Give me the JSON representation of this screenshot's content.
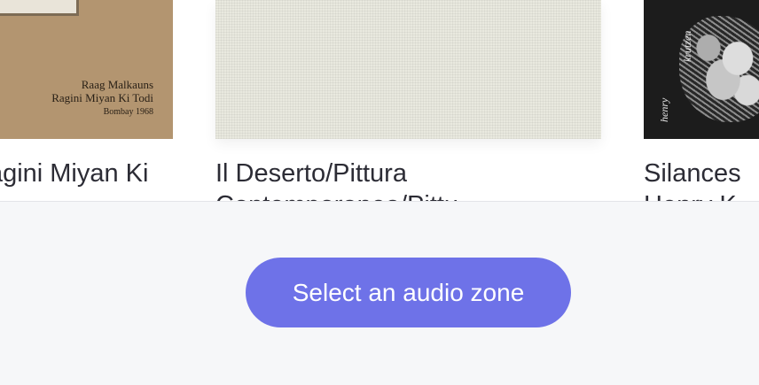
{
  "albums": [
    {
      "title": "Ragini Miyan Ki",
      "subtitle_fragment": "?",
      "cover": {
        "text_line_1": "Raag Malkauns",
        "text_line_2": "Ragini Miyan Ki Todi",
        "text_line_3": "Bombay 1968"
      }
    },
    {
      "title": "Il Deserto/Pittura",
      "subtitle_fragment": "Contemporanea/Pittu"
    },
    {
      "title": "Silances",
      "subtitle_fragment": "Henry K",
      "cover": {
        "text_line_1": "krutzen",
        "text_line_2": "henry"
      }
    }
  ],
  "zone_button": {
    "label": "Select an audio zone"
  },
  "colors": {
    "accent": "#6e72e8",
    "panel_bg": "#f6f7f9"
  }
}
